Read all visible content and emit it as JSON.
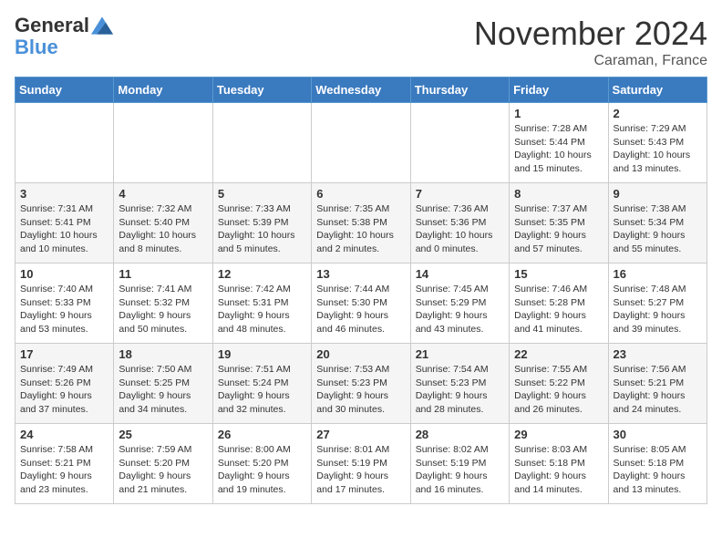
{
  "header": {
    "logo_line1": "General",
    "logo_line2": "Blue",
    "month": "November 2024",
    "location": "Caraman, France"
  },
  "days_of_week": [
    "Sunday",
    "Monday",
    "Tuesday",
    "Wednesday",
    "Thursday",
    "Friday",
    "Saturday"
  ],
  "weeks": [
    [
      {
        "day": "",
        "info": ""
      },
      {
        "day": "",
        "info": ""
      },
      {
        "day": "",
        "info": ""
      },
      {
        "day": "",
        "info": ""
      },
      {
        "day": "",
        "info": ""
      },
      {
        "day": "1",
        "info": "Sunrise: 7:28 AM\nSunset: 5:44 PM\nDaylight: 10 hours and 15 minutes."
      },
      {
        "day": "2",
        "info": "Sunrise: 7:29 AM\nSunset: 5:43 PM\nDaylight: 10 hours and 13 minutes."
      }
    ],
    [
      {
        "day": "3",
        "info": "Sunrise: 7:31 AM\nSunset: 5:41 PM\nDaylight: 10 hours and 10 minutes."
      },
      {
        "day": "4",
        "info": "Sunrise: 7:32 AM\nSunset: 5:40 PM\nDaylight: 10 hours and 8 minutes."
      },
      {
        "day": "5",
        "info": "Sunrise: 7:33 AM\nSunset: 5:39 PM\nDaylight: 10 hours and 5 minutes."
      },
      {
        "day": "6",
        "info": "Sunrise: 7:35 AM\nSunset: 5:38 PM\nDaylight: 10 hours and 2 minutes."
      },
      {
        "day": "7",
        "info": "Sunrise: 7:36 AM\nSunset: 5:36 PM\nDaylight: 10 hours and 0 minutes."
      },
      {
        "day": "8",
        "info": "Sunrise: 7:37 AM\nSunset: 5:35 PM\nDaylight: 9 hours and 57 minutes."
      },
      {
        "day": "9",
        "info": "Sunrise: 7:38 AM\nSunset: 5:34 PM\nDaylight: 9 hours and 55 minutes."
      }
    ],
    [
      {
        "day": "10",
        "info": "Sunrise: 7:40 AM\nSunset: 5:33 PM\nDaylight: 9 hours and 53 minutes."
      },
      {
        "day": "11",
        "info": "Sunrise: 7:41 AM\nSunset: 5:32 PM\nDaylight: 9 hours and 50 minutes."
      },
      {
        "day": "12",
        "info": "Sunrise: 7:42 AM\nSunset: 5:31 PM\nDaylight: 9 hours and 48 minutes."
      },
      {
        "day": "13",
        "info": "Sunrise: 7:44 AM\nSunset: 5:30 PM\nDaylight: 9 hours and 46 minutes."
      },
      {
        "day": "14",
        "info": "Sunrise: 7:45 AM\nSunset: 5:29 PM\nDaylight: 9 hours and 43 minutes."
      },
      {
        "day": "15",
        "info": "Sunrise: 7:46 AM\nSunset: 5:28 PM\nDaylight: 9 hours and 41 minutes."
      },
      {
        "day": "16",
        "info": "Sunrise: 7:48 AM\nSunset: 5:27 PM\nDaylight: 9 hours and 39 minutes."
      }
    ],
    [
      {
        "day": "17",
        "info": "Sunrise: 7:49 AM\nSunset: 5:26 PM\nDaylight: 9 hours and 37 minutes."
      },
      {
        "day": "18",
        "info": "Sunrise: 7:50 AM\nSunset: 5:25 PM\nDaylight: 9 hours and 34 minutes."
      },
      {
        "day": "19",
        "info": "Sunrise: 7:51 AM\nSunset: 5:24 PM\nDaylight: 9 hours and 32 minutes."
      },
      {
        "day": "20",
        "info": "Sunrise: 7:53 AM\nSunset: 5:23 PM\nDaylight: 9 hours and 30 minutes."
      },
      {
        "day": "21",
        "info": "Sunrise: 7:54 AM\nSunset: 5:23 PM\nDaylight: 9 hours and 28 minutes."
      },
      {
        "day": "22",
        "info": "Sunrise: 7:55 AM\nSunset: 5:22 PM\nDaylight: 9 hours and 26 minutes."
      },
      {
        "day": "23",
        "info": "Sunrise: 7:56 AM\nSunset: 5:21 PM\nDaylight: 9 hours and 24 minutes."
      }
    ],
    [
      {
        "day": "24",
        "info": "Sunrise: 7:58 AM\nSunset: 5:21 PM\nDaylight: 9 hours and 23 minutes."
      },
      {
        "day": "25",
        "info": "Sunrise: 7:59 AM\nSunset: 5:20 PM\nDaylight: 9 hours and 21 minutes."
      },
      {
        "day": "26",
        "info": "Sunrise: 8:00 AM\nSunset: 5:20 PM\nDaylight: 9 hours and 19 minutes."
      },
      {
        "day": "27",
        "info": "Sunrise: 8:01 AM\nSunset: 5:19 PM\nDaylight: 9 hours and 17 minutes."
      },
      {
        "day": "28",
        "info": "Sunrise: 8:02 AM\nSunset: 5:19 PM\nDaylight: 9 hours and 16 minutes."
      },
      {
        "day": "29",
        "info": "Sunrise: 8:03 AM\nSunset: 5:18 PM\nDaylight: 9 hours and 14 minutes."
      },
      {
        "day": "30",
        "info": "Sunrise: 8:05 AM\nSunset: 5:18 PM\nDaylight: 9 hours and 13 minutes."
      }
    ]
  ]
}
